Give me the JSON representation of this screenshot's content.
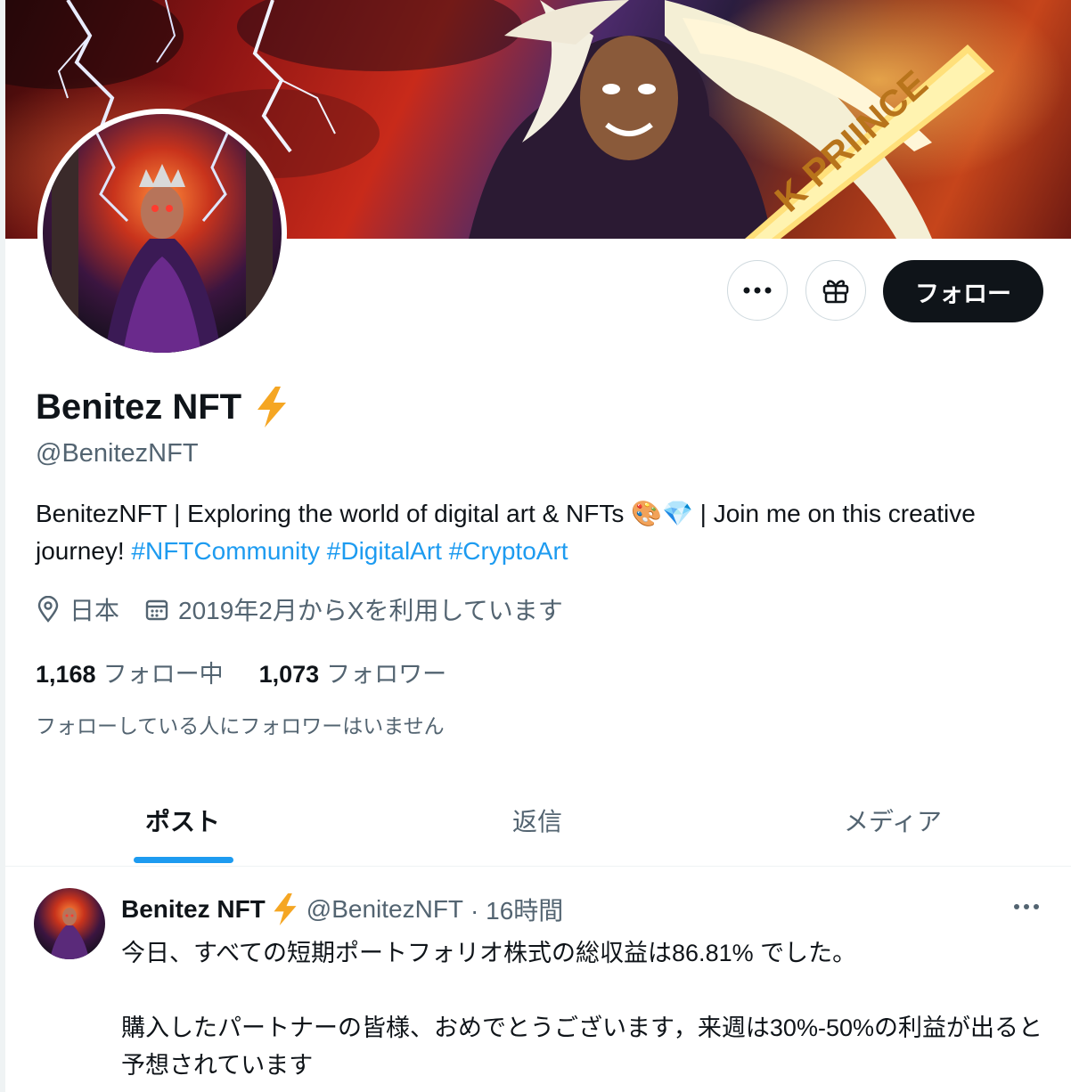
{
  "profile": {
    "display_name": "Benitez NFT",
    "handle": "@BenitezNFT",
    "bio_text_1": "BenitezNFT | Exploring the world of digital art & NFTs 🎨💎 | Join me on this creative journey!",
    "hashtags": [
      "#NFTCommunity",
      "#DigitalArt",
      "#CryptoArt"
    ],
    "location": "日本",
    "joined": "2019年2月からXを利用しています",
    "following_count": "1,168",
    "following_label": "フォロー中",
    "followers_count": "1,073",
    "followers_label": "フォロワー",
    "no_mutuals": "フォローしている人にフォロワーはいません",
    "banner_text": "K PRIINCE"
  },
  "actions": {
    "follow_label": "フォロー",
    "more_icon": "more-horizontal-icon",
    "gift_icon": "gift-icon"
  },
  "tabs": [
    {
      "label": "ポスト",
      "active": true
    },
    {
      "label": "返信",
      "active": false
    },
    {
      "label": "メディア",
      "active": false
    }
  ],
  "post": {
    "name": "Benitez NFT",
    "handle": "@BenitezNFT",
    "time": "· 16時間",
    "text": "今日、すべての短期ポートフォリオ株式の総収益は86.81% でした。\n\n購入したパートナーの皆様、おめでとうございます，来週は30%-50%の利益が出ると予想されています"
  },
  "colors": {
    "accent": "#1d9bf0",
    "text_primary": "#0f1419",
    "text_secondary": "#536471",
    "border": "#cfd9de",
    "lightning_emoji": "#f5a623"
  }
}
